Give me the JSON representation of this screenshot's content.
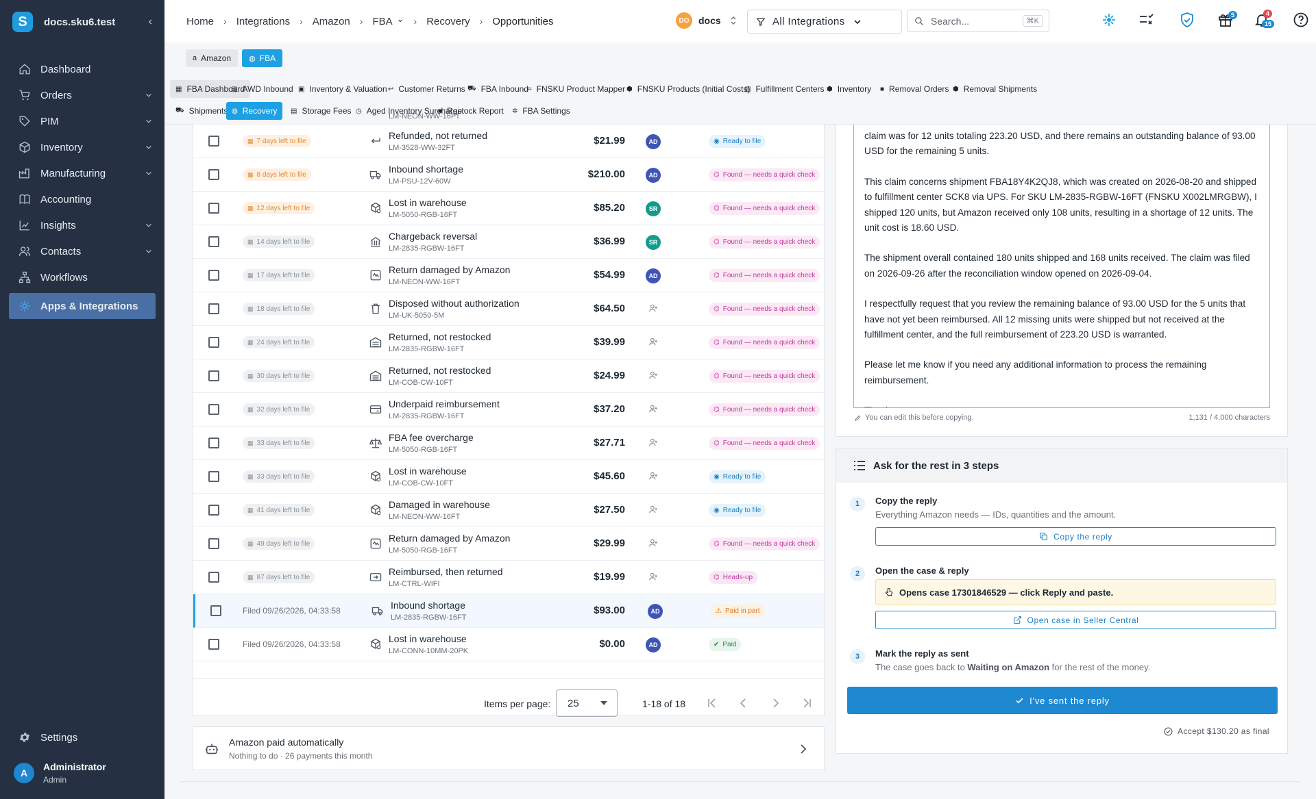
{
  "sidebar": {
    "workspace": "docs.sku6.test",
    "logo_letter": "S",
    "items": [
      {
        "label": "Dashboard",
        "icon": "home-icon",
        "expandable": false
      },
      {
        "label": "Orders",
        "icon": "cart-icon",
        "expandable": true
      },
      {
        "label": "PIM",
        "icon": "tag-icon",
        "expandable": true
      },
      {
        "label": "Inventory",
        "icon": "box-icon",
        "expandable": true
      },
      {
        "label": "Manufacturing",
        "icon": "factory-icon",
        "expandable": true
      },
      {
        "label": "Accounting",
        "icon": "book-icon",
        "expandable": false
      },
      {
        "label": "Insights",
        "icon": "chart-icon",
        "expandable": true
      },
      {
        "label": "Contacts",
        "icon": "contacts-icon",
        "expandable": true
      },
      {
        "label": "Workflows",
        "icon": "workflow-icon",
        "expandable": false
      },
      {
        "label": "Apps & Integrations",
        "icon": "gear-icon",
        "expandable": false,
        "active": true
      }
    ],
    "settings": "Settings",
    "user": {
      "initial": "A",
      "name": "Administrator",
      "role": "Admin"
    }
  },
  "header": {
    "breadcrumbs": [
      "Home",
      "Integrations",
      "Amazon",
      "FBA",
      "Recovery",
      "Opportunities"
    ],
    "workspace_badge": "DO",
    "workspace_name": "docs",
    "filter_label": "All Integrations",
    "search_placeholder": "Search...",
    "search_shortcut": "⌘K",
    "gift_count": "5",
    "notif_count_red": "4",
    "notif_count_blue": "15"
  },
  "chips": [
    "Amazon",
    "FBA"
  ],
  "subnav": {
    "row1": [
      "FBA Dashboard",
      "AWD Inbound",
      "Inventory & Valuation",
      "Customer Returns",
      "FBA Inbound",
      "FNSKU Product Mapper",
      "FNSKU Products (Initial Costs)",
      "Fulfillment Centers",
      "Inventory",
      "Removal Orders",
      "Removal Shipments"
    ],
    "row2": [
      "Shipments Detail",
      "Recovery",
      "Storage Fees",
      "Aged Inventory Surcharge",
      "Restock Report",
      "FBA Settings"
    ]
  },
  "rows": [
    {
      "deadline": "7 days left to file",
      "urgency": "warn",
      "icon": "return-arrow-icon",
      "title": "Refunded, not returned",
      "sku": "LM-3528-WW-32FT",
      "amount": "$21.99",
      "assignee": "AD",
      "status": "Ready to file",
      "status_type": "ready"
    },
    {
      "deadline": "8 days left to file",
      "urgency": "warn",
      "icon": "truck-icon",
      "title": "Inbound shortage",
      "sku": "LM-PSU-12V-60W",
      "amount": "$210.00",
      "assignee": "AD",
      "status": "Found — needs a quick check",
      "status_type": "found"
    },
    {
      "deadline": "12 days left to file",
      "urgency": "warn",
      "icon": "lost-box-icon",
      "title": "Lost in warehouse",
      "sku": "LM-5050-RGB-16FT",
      "amount": "$85.20",
      "assignee": "SR",
      "status": "Found — needs a quick check",
      "status_type": "found"
    },
    {
      "deadline": "14 days left to file",
      "urgency": "muted",
      "icon": "bank-icon",
      "title": "Chargeback reversal",
      "sku": "LM-2835-RGBW-16FT",
      "amount": "$36.99",
      "assignee": "SR",
      "status": "Found — needs a quick check",
      "status_type": "found"
    },
    {
      "deadline": "17 days left to file",
      "urgency": "muted",
      "icon": "damaged-box-icon",
      "title": "Return damaged by Amazon",
      "sku": "LM-NEON-WW-16FT",
      "amount": "$54.99",
      "assignee": "AD",
      "status": "Found — needs a quick check",
      "status_type": "found"
    },
    {
      "deadline": "18 days left to file",
      "urgency": "muted",
      "icon": "trash-icon",
      "title": "Disposed without authorization",
      "sku": "LM-UK-5050-5M",
      "amount": "$64.50",
      "assignee": "",
      "status": "Found — needs a quick check",
      "status_type": "found"
    },
    {
      "deadline": "24 days left to file",
      "urgency": "muted",
      "icon": "warehouse-icon",
      "title": "Returned, not restocked",
      "sku": "LM-2835-RGBW-16FT",
      "amount": "$39.99",
      "assignee": "",
      "status": "Found — needs a quick check",
      "status_type": "found"
    },
    {
      "deadline": "30 days left to file",
      "urgency": "muted",
      "icon": "warehouse-icon",
      "title": "Returned, not restocked",
      "sku": "LM-COB-CW-10FT",
      "amount": "$24.99",
      "assignee": "",
      "status": "Found — needs a quick check",
      "status_type": "found"
    },
    {
      "deadline": "32 days left to file",
      "urgency": "muted",
      "icon": "underpaid-icon",
      "title": "Underpaid reimbursement",
      "sku": "LM-2835-RGBW-16FT",
      "amount": "$37.20",
      "assignee": "",
      "status": "Found — needs a quick check",
      "status_type": "found"
    },
    {
      "deadline": "33 days left to file",
      "urgency": "muted",
      "icon": "scale-icon",
      "title": "FBA fee overcharge",
      "sku": "LM-5050-RGB-16FT",
      "amount": "$27.71",
      "assignee": "",
      "status": "Found — needs a quick check",
      "status_type": "found"
    },
    {
      "deadline": "33 days left to file",
      "urgency": "muted",
      "icon": "lost-box-icon",
      "title": "Lost in warehouse",
      "sku": "LM-COB-CW-10FT",
      "amount": "$45.60",
      "assignee": "",
      "status": "Ready to file",
      "status_type": "ready"
    },
    {
      "deadline": "41 days left to file",
      "urgency": "muted",
      "icon": "lost-box-icon",
      "title": "Damaged in warehouse",
      "sku": "LM-NEON-WW-16FT",
      "amount": "$27.50",
      "assignee": "",
      "status": "Ready to file",
      "status_type": "ready"
    },
    {
      "deadline": "49 days left to file",
      "urgency": "muted",
      "icon": "damaged-box-icon",
      "title": "Return damaged by Amazon",
      "sku": "LM-5050-RGB-16FT",
      "amount": "$29.99",
      "assignee": "",
      "status": "Found — needs a quick check",
      "status_type": "found"
    },
    {
      "deadline": "87 days left to file",
      "urgency": "muted",
      "icon": "reimbursed-icon",
      "title": "Reimbursed, then returned",
      "sku": "LM-CTRL-WIFI",
      "amount": "$19.99",
      "assignee": "",
      "status": "Heads-up",
      "status_type": "heads"
    },
    {
      "filed": "Filed 09/26/2026, 04:33:58",
      "icon": "truck-icon",
      "title": "Inbound shortage",
      "sku": "LM-2835-RGBW-16FT",
      "amount": "$93.00",
      "assignee": "AD",
      "status": "Paid in part",
      "status_type": "part",
      "selected": true
    },
    {
      "filed": "Filed 09/26/2026, 04:33:58",
      "icon": "lost-box-icon",
      "title": "Lost in warehouse",
      "sku": "LM-CONN-10MM-20PK",
      "amount": "$0.00",
      "assignee": "AD",
      "status": "Paid",
      "status_type": "paid"
    }
  ],
  "pagination": {
    "label": "Items per page:",
    "per_page": "25",
    "range": "1-18 of 18"
  },
  "auto_paid": {
    "title": "Amazon paid automatically",
    "subtitle": "Nothing to do · 26 payments this month"
  },
  "letter": {
    "paragraphs": [
      "claim was for 12 units totaling 223.20 USD, and there remains an outstanding balance of 93.00 USD for the remaining 5 units.",
      "This claim concerns shipment FBA18Y4K2QJ8, which was created on 2026-08-20 and shipped to fulfillment center SCK8 via UPS. For SKU LM-2835-RGBW-16FT (FNSKU X002LMRGBW), I shipped 120 units, but Amazon received only 108 units, resulting in a shortage of 12 units. The unit cost is 18.60 USD.",
      "The shipment overall contained 180 units shipped and 168 units received. The claim was filed on 2026-09-26 after the reconciliation window opened on 2026-09-04.",
      "I respectfully request that you review the remaining balance of 93.00 USD for the 5 units that have not yet been reimbursed. All 12 missing units were shipped but not received at the fulfillment center, and the full reimbursement of 223.20 USD is warranted.",
      "Please let me know if you need any additional information to process the remaining reimbursement.",
      "Thank you."
    ],
    "hint": "You can edit this before copying.",
    "count": "1,131 / 4,000 characters"
  },
  "steps": {
    "title": "Ask for the rest in 3 steps",
    "step1": {
      "num": "1",
      "title": "Copy the reply",
      "desc": "Everything Amazon needs — IDs, quantities and the amount.",
      "button": "Copy the reply"
    },
    "step2": {
      "num": "2",
      "title": "Open the case & reply",
      "note": "Opens case 17301846529 — click Reply and paste.",
      "button": "Open case in Seller Central"
    },
    "step3": {
      "num": "3",
      "title": "Mark the reply as sent",
      "desc_pre": "The case goes back to ",
      "desc_bold": "Waiting on Amazon",
      "desc_post": " for the rest of the money."
    },
    "primary": "I've sent the reply",
    "accept": "Accept $130.20 as final"
  },
  "colors": {
    "sidebar_bg": "#253142",
    "accent": "#1ea1e4",
    "primary_btn": "#1e88d0"
  }
}
